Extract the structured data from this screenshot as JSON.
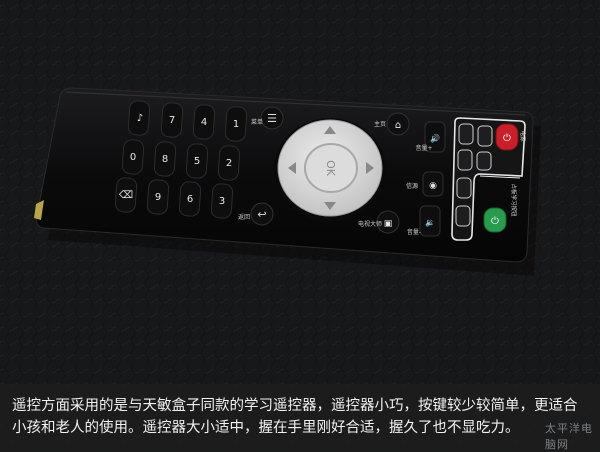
{
  "remote": {
    "number_keys": [
      "1",
      "2",
      "3",
      "4",
      "5",
      "6",
      "7",
      "8",
      "9",
      "0"
    ],
    "ok_label": "OK",
    "side_labels": {
      "menu": "菜单",
      "back": "返回",
      "home": "主页",
      "tv_guide": "电视大师",
      "volume_up": "音量+",
      "volume_down": "音量-",
      "source": "信源",
      "power": "电源",
      "learn": "占板学习按钮"
    }
  },
  "caption": {
    "line1": "遥控方面采用的是与天敏盒子同款的学习遥控器，遥控器小巧，按键较少较简单，更适合",
    "line2": "小孩和老人的使用。遥控器大小适中，握在手里刚好合适，握久了也不显吃力。"
  },
  "watermark": "太平洋电脑网",
  "colors": {
    "background": "#1b1c1e",
    "remote_body": "#0b0b0c",
    "dpad": "#d7d7d7",
    "power_button": "#c8202a",
    "green_button": "#2a9a4e"
  }
}
